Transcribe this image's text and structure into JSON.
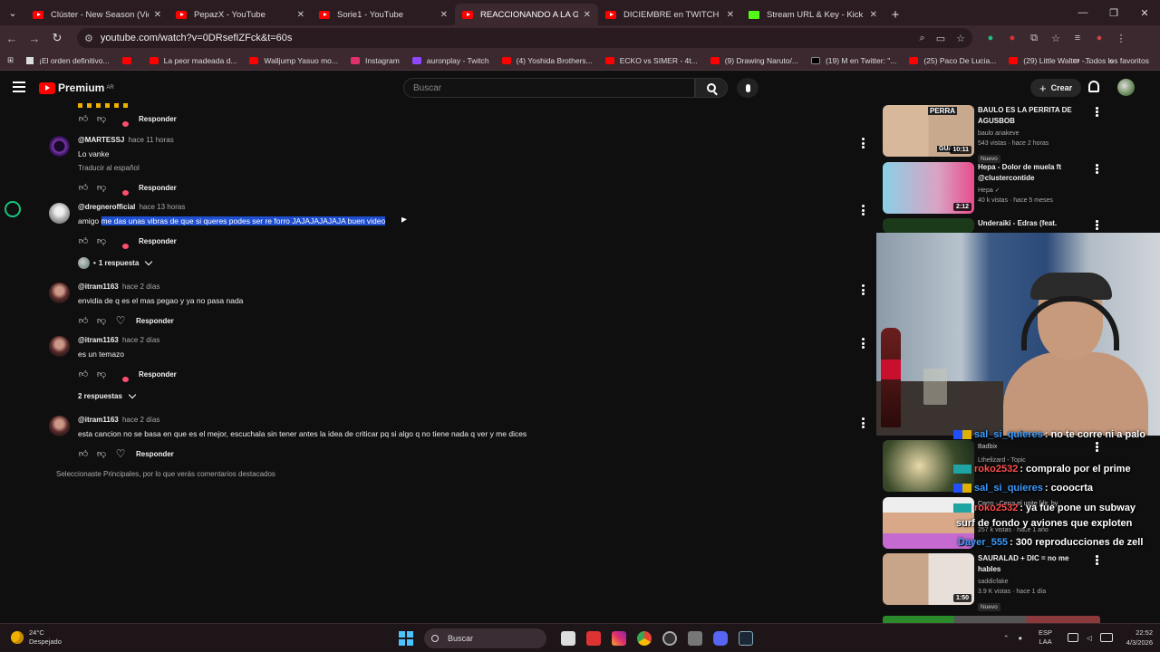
{
  "browser": {
    "tabs": [
      {
        "title": "Clúster - New Season (Video O",
        "favicon": "youtube"
      },
      {
        "title": "PepazX - YouTube",
        "favicon": "youtube"
      },
      {
        "title": "Sorie1 - YouTube",
        "favicon": "youtube"
      },
      {
        "title": "REACCIONANDO A LA GALLER",
        "favicon": "youtube",
        "active": true
      },
      {
        "title": "DICIEMBRE en TWITCH y KICK",
        "favicon": "youtube"
      },
      {
        "title": "Stream URL & Key - Kick Dashb",
        "favicon": "kick"
      }
    ],
    "url": "youtube.com/watch?v=0DRsefIZFck&t=60s",
    "bookmarks": [
      {
        "label": "¡El orden definitivo...",
        "icon": "doc-icon"
      },
      {
        "label": "",
        "icon": "youtube-icon"
      },
      {
        "label": "La peor madeada d...",
        "icon": "youtube-icon"
      },
      {
        "label": "Walljump Yasuo mo...",
        "icon": "youtube-icon"
      },
      {
        "label": "Instagram",
        "icon": "instagram-icon"
      },
      {
        "label": "auronplay - Twitch",
        "icon": "twitch-icon"
      },
      {
        "label": "(4) Yoshida Brothers...",
        "icon": "youtube-icon"
      },
      {
        "label": "ECKO vs SIMER - 4t...",
        "icon": "youtube-icon"
      },
      {
        "label": "(9) Drawing Naruto/...",
        "icon": "youtube-icon"
      },
      {
        "label": "(19) M en Twitter: \"...",
        "icon": "x-icon"
      },
      {
        "label": "(25) Paco De Lucia...",
        "icon": "youtube-icon"
      },
      {
        "label": "(29) Little Walter -...",
        "icon": "youtube-icon"
      }
    ],
    "all_bookmarks_label": "Todos los favoritos",
    "more_bookmarks": "»"
  },
  "youtube": {
    "logo_text": "Premium",
    "logo_region": "AR",
    "search_placeholder": "Buscar",
    "create_label": "Crear"
  },
  "comments": [
    {
      "author": "",
      "time": "",
      "text": "",
      "translate": "",
      "reply": "Responder",
      "creator_heart": true,
      "partial": true
    },
    {
      "author": "@MARTESSJ",
      "time": "hace 11 horas",
      "text": "Lo vanke",
      "translate": "Traducir al español",
      "reply": "Responder",
      "creator_heart": true
    },
    {
      "author": "@dregnerofficial",
      "time": "hace 13 horas",
      "text_plain": "amigo ",
      "text_highlight": "me das unas vibras de que si queres podes ser re forro JAJAJAJAJAJA buen video",
      "reply": "Responder",
      "creator_heart": true,
      "replies": "1 respuesta"
    },
    {
      "author": "@itram1163",
      "time": "hace 2 días",
      "text": "envidia de q es el mas pegao y ya no pasa nada",
      "reply": "Responder",
      "creator_heart": false
    },
    {
      "author": "@itram1163",
      "time": "hace 2 días",
      "text": "es un temazo",
      "reply": "Responder",
      "creator_heart": true,
      "replies": "2 respuestas"
    },
    {
      "author": "@itram1163",
      "time": "hace 2 días",
      "text": "esta cancion no se basa en que es el mejor, escuchala sin tener antes la idea de criticar pq si algo q no tiene nada q ver y me dices",
      "reply": "Responder",
      "creator_heart": false
    }
  ],
  "footer_note": "Seleccionaste Principales, por lo que verás comentarios destacados",
  "recommendations": [
    {
      "title": "BAULO ES LA PERRITA DE AGUSBOB",
      "channel": "baulo anakeve",
      "meta": "543 vistas · hace 2 horas",
      "badge": "Nuevo",
      "duration": "10:11",
      "thumb_text_1": "PERRA",
      "thumb_text_2": "GUAU"
    },
    {
      "title": "Hepa - Dolor de muela ft @clustercontide",
      "channel": "Hepa ✓",
      "meta": "40 k vistas · hace 5 meses",
      "duration": "2:12"
    },
    {
      "title": "Underaiki - Edras (feat.",
      "channel": "",
      "meta": ""
    },
    {
      "title": "",
      "channel": "Badbix",
      "meta": "Lthelizard - Topic"
    },
    {
      "title": "",
      "channel": "Cerro - Cerra el upite [dir. by",
      "meta": "257 k vistas · hace 1 año"
    },
    {
      "title": "SAURALAD + DIC = no me hables",
      "channel": "saddicfake",
      "meta": "3.9 K vistas · hace 1 día",
      "badge": "Nuevo",
      "duration": "1:50"
    }
  ],
  "chat": [
    {
      "user": "sal_si_quieres",
      "user_color": "#3d9bff",
      "msg": ": no te corre ni a palo",
      "badge": "sub"
    },
    {
      "user": "roko2532",
      "user_color": "#ff4e4e",
      "msg": ": compralo por el prime",
      "badge": "mod"
    },
    {
      "user": "sal_si_quieres",
      "user_color": "#3d9bff",
      "msg": ": cooocrta",
      "badge": "sub"
    },
    {
      "user": "roko2532",
      "user_color": "#ff4e4e",
      "msg": ": ya fue pone un subway",
      "badge": "mod"
    },
    {
      "user": "",
      "user_color": "#ffffff",
      "msg": "surf de fondo y aviones que exploten",
      "badge": ""
    },
    {
      "user": "Dayer_555",
      "user_color": "#3d9bff",
      "msg": ": 300 reproducciones de zell",
      "badge": ""
    }
  ],
  "taskbar": {
    "temp": "24°C",
    "weather": "Despejado",
    "search": "Buscar",
    "lang_1": "ESP",
    "lang_2": "LAA",
    "time": "22:52",
    "date": "4/3/2026"
  },
  "colors": {
    "highlight": "#1e4fd0",
    "youtube_red": "#ff0000",
    "background": "#0f0f0f",
    "browser_frame": "#3c2930"
  }
}
